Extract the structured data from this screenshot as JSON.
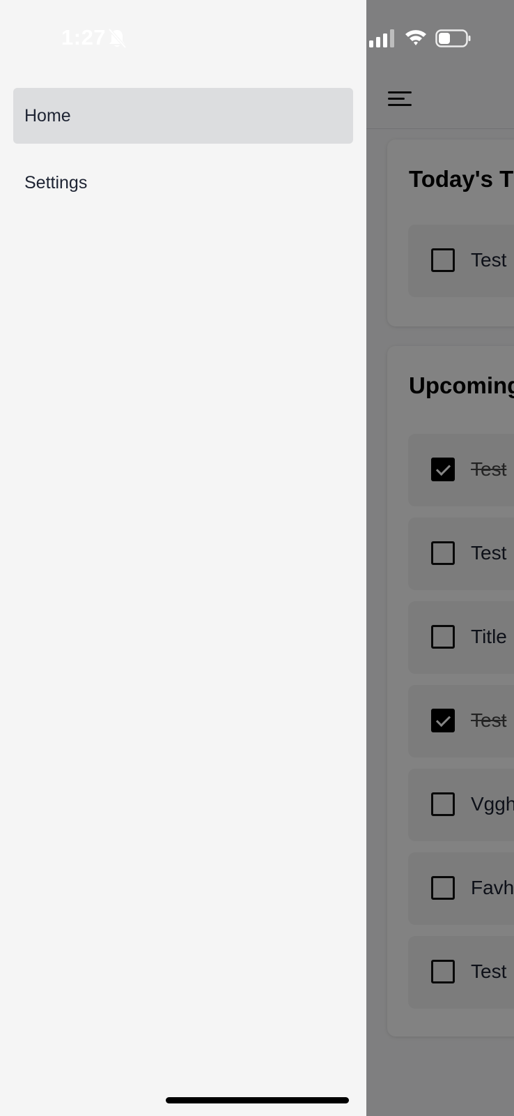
{
  "status_bar": {
    "time": "1:27",
    "icons": [
      "bell-off-icon",
      "signal-icon",
      "wifi-icon",
      "battery-icon"
    ]
  },
  "drawer": {
    "items": [
      {
        "label": "Home",
        "active": true
      },
      {
        "label": "Settings",
        "active": false
      }
    ]
  },
  "main": {
    "menu_icon": "hamburger-icon",
    "today": {
      "title": "Today's T",
      "tasks": [
        {
          "label": "Test",
          "checked": false
        }
      ]
    },
    "upcoming": {
      "title": "Upcoming",
      "tasks": [
        {
          "label": "Test",
          "checked": true
        },
        {
          "label": "Test",
          "checked": false
        },
        {
          "label": "Title",
          "checked": false
        },
        {
          "label": "Test",
          "checked": true
        },
        {
          "label": "Vggh",
          "checked": false
        },
        {
          "label": "Favh",
          "checked": false
        },
        {
          "label": "Test",
          "checked": false
        }
      ]
    }
  },
  "colors": {
    "drawer_bg": "#f5f5f5",
    "active_item_bg": "#dcdddf",
    "scrim": "rgba(0,0,0,0.48)",
    "text": "#1e2433"
  }
}
